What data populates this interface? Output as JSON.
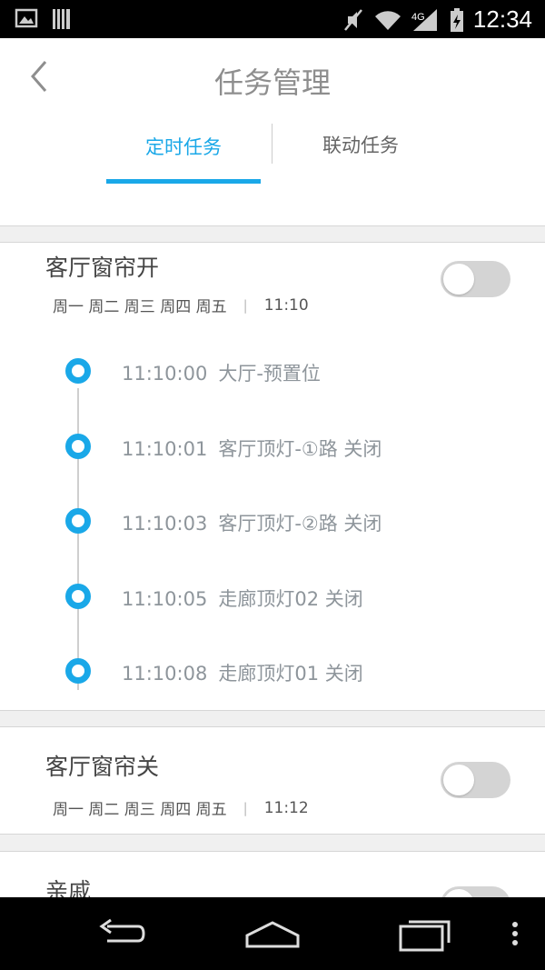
{
  "status_bar": {
    "time": "12:34",
    "left_icons": [
      "image-icon",
      "barcode-icon"
    ],
    "right_icons": [
      "mute-icon",
      "wifi-icon",
      "signal-icon",
      "battery-charging-icon"
    ]
  },
  "header": {
    "title": "任务管理",
    "tabs": [
      {
        "label": "定时任务",
        "active": true
      },
      {
        "label": "联动任务",
        "active": false
      }
    ]
  },
  "accent_color": "#1aa8e8",
  "tasks": [
    {
      "name": "客厅窗帘开",
      "days": "周一 周二 周三 周四 周五",
      "separator": "|",
      "time": "11:10",
      "enabled": false,
      "steps": [
        {
          "time": "11:10:00",
          "action": "大厅-预置位"
        },
        {
          "time": "11:10:01",
          "action": "客厅顶灯-①路  关闭"
        },
        {
          "time": "11:10:03",
          "action": "客厅顶灯-②路  关闭"
        },
        {
          "time": "11:10:05",
          "action": "走廊顶灯02  关闭"
        },
        {
          "time": "11:10:08",
          "action": "走廊顶灯01  关闭"
        }
      ]
    },
    {
      "name": "客厅窗帘关",
      "days": "周一 周二 周三 周四 周五",
      "separator": "|",
      "time": "11:12",
      "enabled": false
    },
    {
      "name": "亲戚",
      "enabled": false
    }
  ],
  "nav_bar": [
    "back-icon",
    "home-icon",
    "recents-icon",
    "overflow-menu-icon"
  ]
}
